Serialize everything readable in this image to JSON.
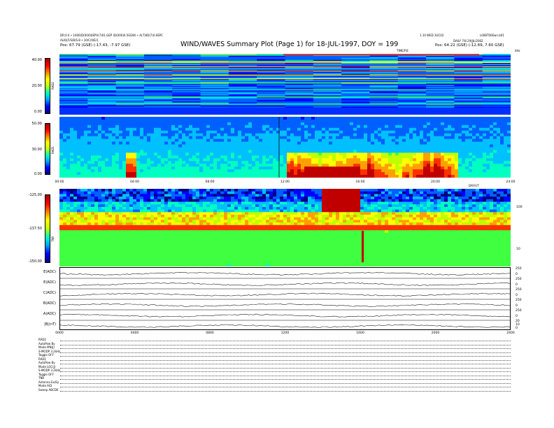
{
  "header": {
    "left_line1": "DR:0.0 • 1000(D(000)0EPV(7)01.GEP (D(000)0.5GEW) • A(7)0D(7)0.0EPC",
    "left_line2": "ALIQ(F/S/B/S.8 • 10/C/0/E/1",
    "left_line3_label": "Pos:",
    "left_line3_value": "67.79 (GSE)  (-17.43, -7.97 GSE)",
    "title": "WIND/WAVES Summary Plot (Page 1) for 18-JUL-1997, DOY = 199",
    "right_line1": "1.10 WED 3UC02",
    "right_line2": "L00BT00Ewn.b01",
    "right_line3": "DAILY  7/8  29/JJL/2002",
    "right_line4_label": "Pos:",
    "right_line4_value": "64.22 (GSE)  (-12.69, 7.60 GSE)",
    "ut_top_label": "TIME/FIE",
    "ut_top_right": "kHz",
    "ut_mid_label": "DAY/UT"
  },
  "colors": {
    "rainbow": [
      "#00007f",
      "#0000ff",
      "#0060ff",
      "#00c0ff",
      "#00ffc0",
      "#40ff40",
      "#c0ff00",
      "#ffff00",
      "#ffa000",
      "#ff3000",
      "#c00000"
    ]
  },
  "chart_data": [
    {
      "type": "heatmap",
      "name": "RAD2",
      "ylabel": "RAD2",
      "yticks": [
        "40.00",
        "20.00",
        "0.00"
      ],
      "description_values": "background intensity with horizontal interference lines"
    },
    {
      "type": "heatmap",
      "name": "RAD1",
      "ylabel": "RAD1",
      "yticks": [
        "50.00",
        "30.00",
        "0.00"
      ],
      "xticks": [
        "00:00",
        "04:00",
        "08:00",
        "12:00",
        "16:00",
        "20:00",
        "24:00"
      ]
    },
    {
      "type": "heatmap",
      "name": "TNR",
      "ylabel": "TNR",
      "yticks": [
        "-125.00",
        "-137.50",
        "-150.00"
      ],
      "right_ticks": [
        "100",
        "10"
      ]
    },
    {
      "type": "line",
      "name": "stack",
      "rows": [
        {
          "label": "E(ADC)",
          "right": [
            "250",
            "0"
          ]
        },
        {
          "label": "E(ADC)",
          "right": [
            "250",
            "0"
          ]
        },
        {
          "label": "C(ADC)",
          "right": [
            "250",
            "0"
          ]
        },
        {
          "label": "B(ADC)",
          "right": [
            "250",
            "0"
          ]
        },
        {
          "label": "A(ADC)",
          "right": [
            "250",
            "0"
          ]
        },
        {
          "label": "|B|(nT)",
          "right": [
            "20",
            "10",
            "0"
          ]
        }
      ],
      "xticks": [
        "0000",
        "0400",
        "0800",
        "1200",
        "1600",
        "2000",
        "2400"
      ]
    }
  ],
  "meta": {
    "rows": [
      {
        "k": "RAD2",
        "v": ""
      },
      {
        "k": "AutoPow",
        "v": "By"
      },
      {
        "k": "Mode",
        "v": "MN(J)"
      },
      {
        "k": "S-MODP",
        "v": "3.2kHz"
      },
      {
        "k": "Toggle",
        "v": "OFF"
      },
      {
        "k": "RAD1",
        "v": ""
      },
      {
        "k": "AutoPow",
        "v": "By"
      },
      {
        "k": "Mode",
        "v": "LOC(J)"
      },
      {
        "k": "S-MODP",
        "v": "3.2kHz"
      },
      {
        "k": "Toggle",
        "v": "OFF"
      },
      {
        "k": "TNR",
        "v": ""
      },
      {
        "k": "Antenna",
        "v": "Ex/Ey"
      },
      {
        "k": "Mode",
        "v": "A/D"
      },
      {
        "k": "Sweep",
        "v": "ABCDE"
      }
    ]
  }
}
